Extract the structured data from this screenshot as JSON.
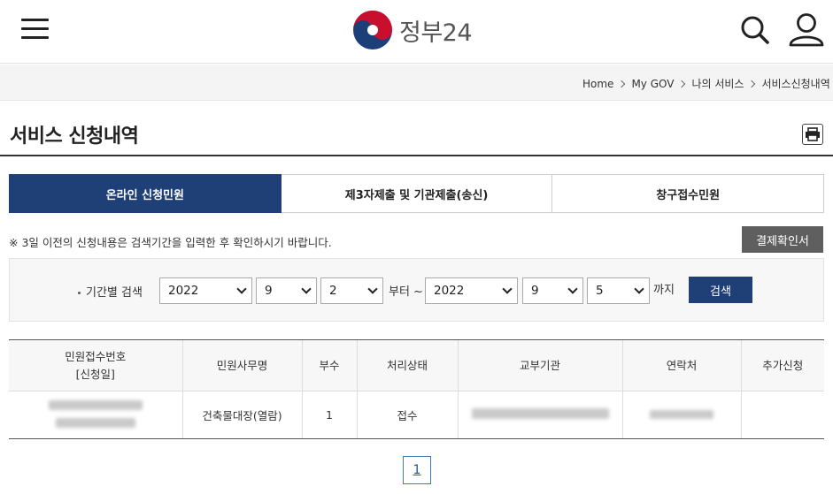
{
  "header": {
    "logo_text": "정부24",
    "menu_icon": "hamburger-menu-icon",
    "search_icon": "search-icon",
    "user_icon": "user-icon"
  },
  "breadcrumb": [
    "Home",
    "My GOV",
    "나의 서비스",
    "서비스신청내역"
  ],
  "page": {
    "title": "서비스 신청내역",
    "print_icon": "printer-icon"
  },
  "tabs": [
    {
      "label": "온라인 신청민원",
      "active": true
    },
    {
      "label": "제3자제출 및 기관제출(송신)",
      "active": false
    },
    {
      "label": "창구접수민원",
      "active": false
    }
  ],
  "notice": "※ 3일 이전의 신청내용은 검색기간을 입력한 후 확인하시기 바랍니다.",
  "payment_button": "결제확인서",
  "search": {
    "label": "기간별 검색",
    "start": {
      "year": "2022",
      "month": "9",
      "day": "2"
    },
    "from_text": "부터 ~",
    "end": {
      "year": "2022",
      "month": "9",
      "day": "5"
    },
    "until_text": "까지",
    "button": "검색"
  },
  "table": {
    "headers": [
      "민원접수번호",
      "[신청일]",
      "민원사무명",
      "부수",
      "처리상태",
      "교부기관",
      "연락처",
      "추가신청"
    ],
    "rows": [
      {
        "service_name": "건축물대장(열람)",
        "copies": "1",
        "status": "접수"
      }
    ]
  },
  "pagination": {
    "current": "1"
  },
  "colors": {
    "primary": "#1f3f77",
    "pay_button": "#5f5f5f",
    "logo_red": "#c8102e",
    "logo_blue": "#1c3f7a"
  }
}
